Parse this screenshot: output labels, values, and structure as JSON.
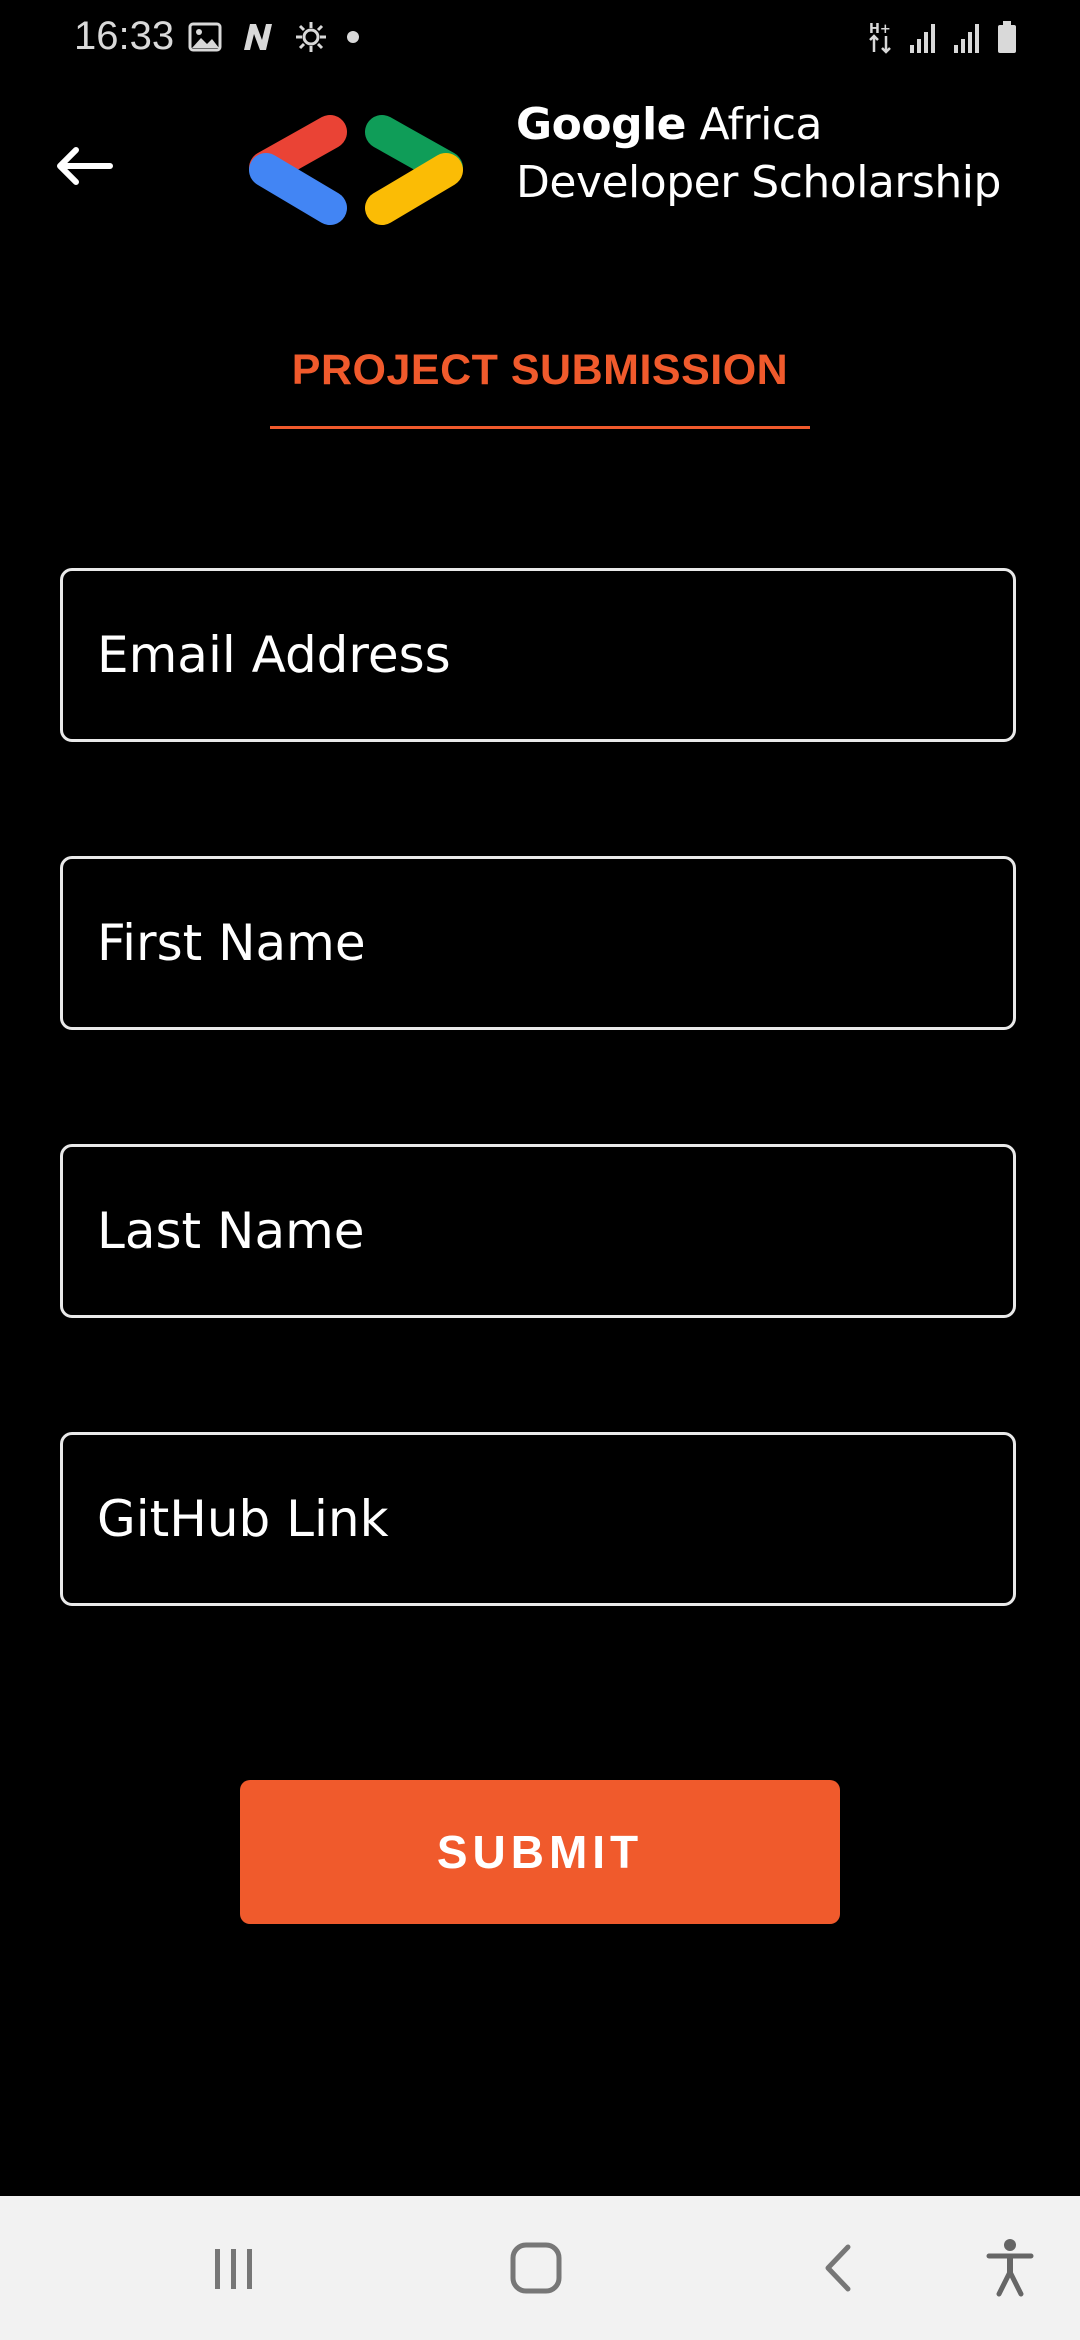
{
  "status_bar": {
    "time": "16:33",
    "left_icons": [
      "image-icon",
      "n-app-icon",
      "settings-cog-icon",
      "dot-icon"
    ],
    "right_icons": [
      "data-arrows-icon",
      "signal-icon",
      "signal-icon-2",
      "battery-icon"
    ]
  },
  "header": {
    "back_icon": "arrow-left-icon",
    "brand_strong": "Google",
    "brand_rest": " Africa",
    "brand_line2": "Developer Scholarship"
  },
  "title": "PROJECT SUBMISSION",
  "form": {
    "email": {
      "value": "",
      "placeholder": "Email Address"
    },
    "first_name": {
      "value": "",
      "placeholder": "First Name"
    },
    "last_name": {
      "value": "",
      "placeholder": "Last Name"
    },
    "github": {
      "value": "",
      "placeholder": "GitHub Link"
    }
  },
  "submit_label": "SUBMIT",
  "nav_bar": {
    "buttons": [
      "recents-icon",
      "home-icon",
      "back-icon",
      "accessibility-icon"
    ]
  },
  "colors": {
    "accent": "#f05a2c",
    "background": "#000000",
    "nav_background": "#f2f2f2",
    "logo_red": "#ea4335",
    "logo_blue": "#4285f4",
    "logo_green": "#0f9d58",
    "logo_yellow": "#fbbc05"
  }
}
